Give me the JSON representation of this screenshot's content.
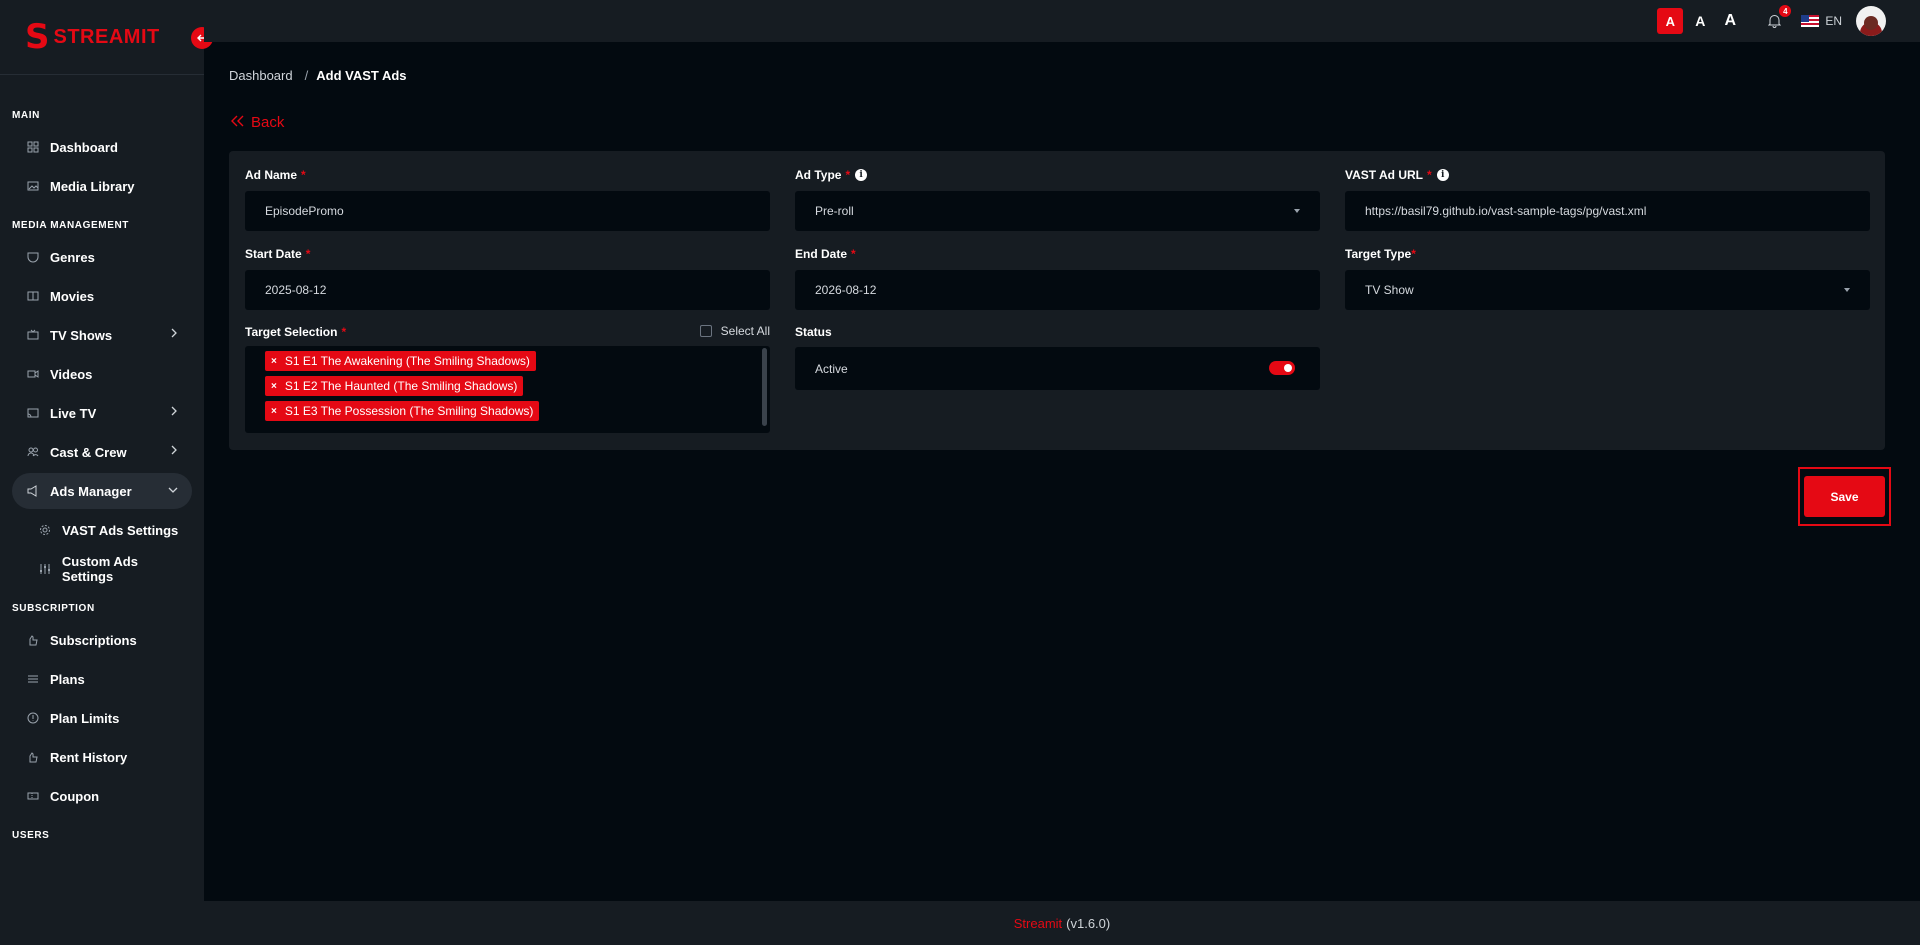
{
  "colors": {
    "accent": "#e50914",
    "background": "#030a10",
    "panel": "#161c22"
  },
  "brand": {
    "letter": "S",
    "name": "STREAMIT"
  },
  "sidebar": {
    "sections": [
      {
        "title": "MAIN",
        "items": [
          {
            "label": "Dashboard",
            "icon": "grid-icon"
          },
          {
            "label": "Media Library",
            "icon": "gallery-icon"
          }
        ]
      },
      {
        "title": "MEDIA MANAGEMENT",
        "items": [
          {
            "label": "Genres",
            "icon": "mask-icon"
          },
          {
            "label": "Movies",
            "icon": "film-icon"
          },
          {
            "label": "TV Shows",
            "icon": "tv-icon",
            "expandable": true
          },
          {
            "label": "Videos",
            "icon": "video-icon"
          },
          {
            "label": "Live TV",
            "icon": "cast-icon",
            "expandable": true
          },
          {
            "label": "Cast & Crew",
            "icon": "people-icon",
            "expandable": true
          },
          {
            "label": "Ads Manager",
            "icon": "megaphone-icon",
            "expanded": true,
            "active": true
          },
          {
            "label": "VAST Ads Settings",
            "icon": "gear-icon",
            "sub": true
          },
          {
            "label": "Custom Ads Settings",
            "icon": "sliders-icon",
            "sub": true
          }
        ]
      },
      {
        "title": "SUBSCRIPTION",
        "items": [
          {
            "label": "Subscriptions",
            "icon": "hand-icon"
          },
          {
            "label": "Plans",
            "icon": "list-icon"
          },
          {
            "label": "Plan Limits",
            "icon": "alert-circle-icon"
          },
          {
            "label": "Rent History",
            "icon": "hand-icon"
          },
          {
            "label": "Coupon",
            "icon": "ticket-icon"
          }
        ]
      },
      {
        "title": "USERS",
        "items": []
      }
    ]
  },
  "topbar": {
    "font_sizes": [
      "A",
      "A",
      "A"
    ],
    "notification_count": "4",
    "language": "EN"
  },
  "breadcrumb": {
    "parent": "Dashboard",
    "separator": "/",
    "current": "Add VAST Ads"
  },
  "back_label": "Back",
  "form": {
    "ad_name": {
      "label": "Ad Name",
      "value": "EpisodePromo"
    },
    "ad_type": {
      "label": "Ad Type",
      "value": "Pre-roll"
    },
    "vast_url": {
      "label": "VAST Ad URL",
      "value": "https://basil79.github.io/vast-sample-tags/pg/vast.xml"
    },
    "start_date": {
      "label": "Start Date",
      "value": "2025-08-12"
    },
    "end_date": {
      "label": "End Date",
      "value": "2026-08-12"
    },
    "target_type": {
      "label": "Target Type",
      "value": "TV Show"
    },
    "target_selection": {
      "label": "Target Selection",
      "select_all_label": "Select All",
      "tags": [
        "S1 E1 The Awakening (The Smiling Shadows)",
        "S1 E2 The Haunted (The Smiling Shadows)",
        "S1 E3 The Possession (The Smiling Shadows)"
      ]
    },
    "status": {
      "label": "Status",
      "value": "Active",
      "enabled": true
    },
    "required_mark": "*",
    "tag_remove": "×"
  },
  "save_label": "Save",
  "footer": {
    "brand": "Streamit",
    "version": "(v1.6.0)"
  }
}
